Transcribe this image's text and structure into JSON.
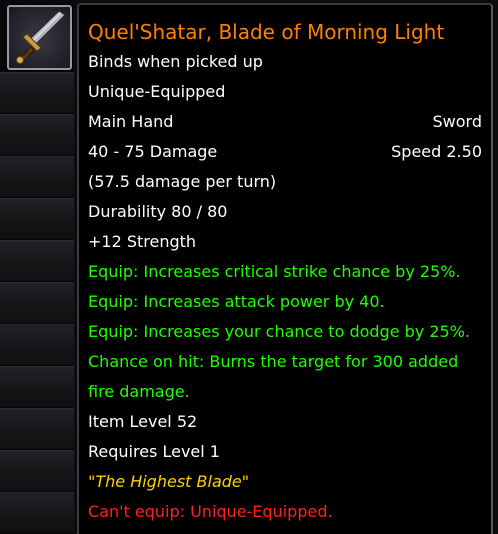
{
  "item": {
    "name": "Quel'Shatar, Blade of Morning Light",
    "icon": "sword-icon",
    "bind": "Binds when picked up",
    "unique": "Unique-Equipped",
    "slot": "Main Hand",
    "type": "Sword",
    "damage": "40 - 75 Damage",
    "speed": "Speed 2.50",
    "dps": "(57.5 damage per turn)",
    "durability": "Durability 80 / 80",
    "stat": "+12 Strength",
    "effects": [
      "Equip: Increases critical strike chance by 25%.",
      "Equip: Increases attack power by 40.",
      "Equip: Increases your chance to dodge by 25%."
    ],
    "on_hit_line1": "Chance on hit: Burns the target for 300 added",
    "on_hit_line2": "fire damage.",
    "item_level": "Item Level 52",
    "required_level": "Requires Level 1",
    "flavor": "\"The Highest Blade\"",
    "error": "Can't equip: Unique-Equipped."
  },
  "colors": {
    "legendary": "#ff8000",
    "white": "#ffffff",
    "green": "#1eff00",
    "flavor": "#ffd100",
    "error": "#ff2020"
  }
}
